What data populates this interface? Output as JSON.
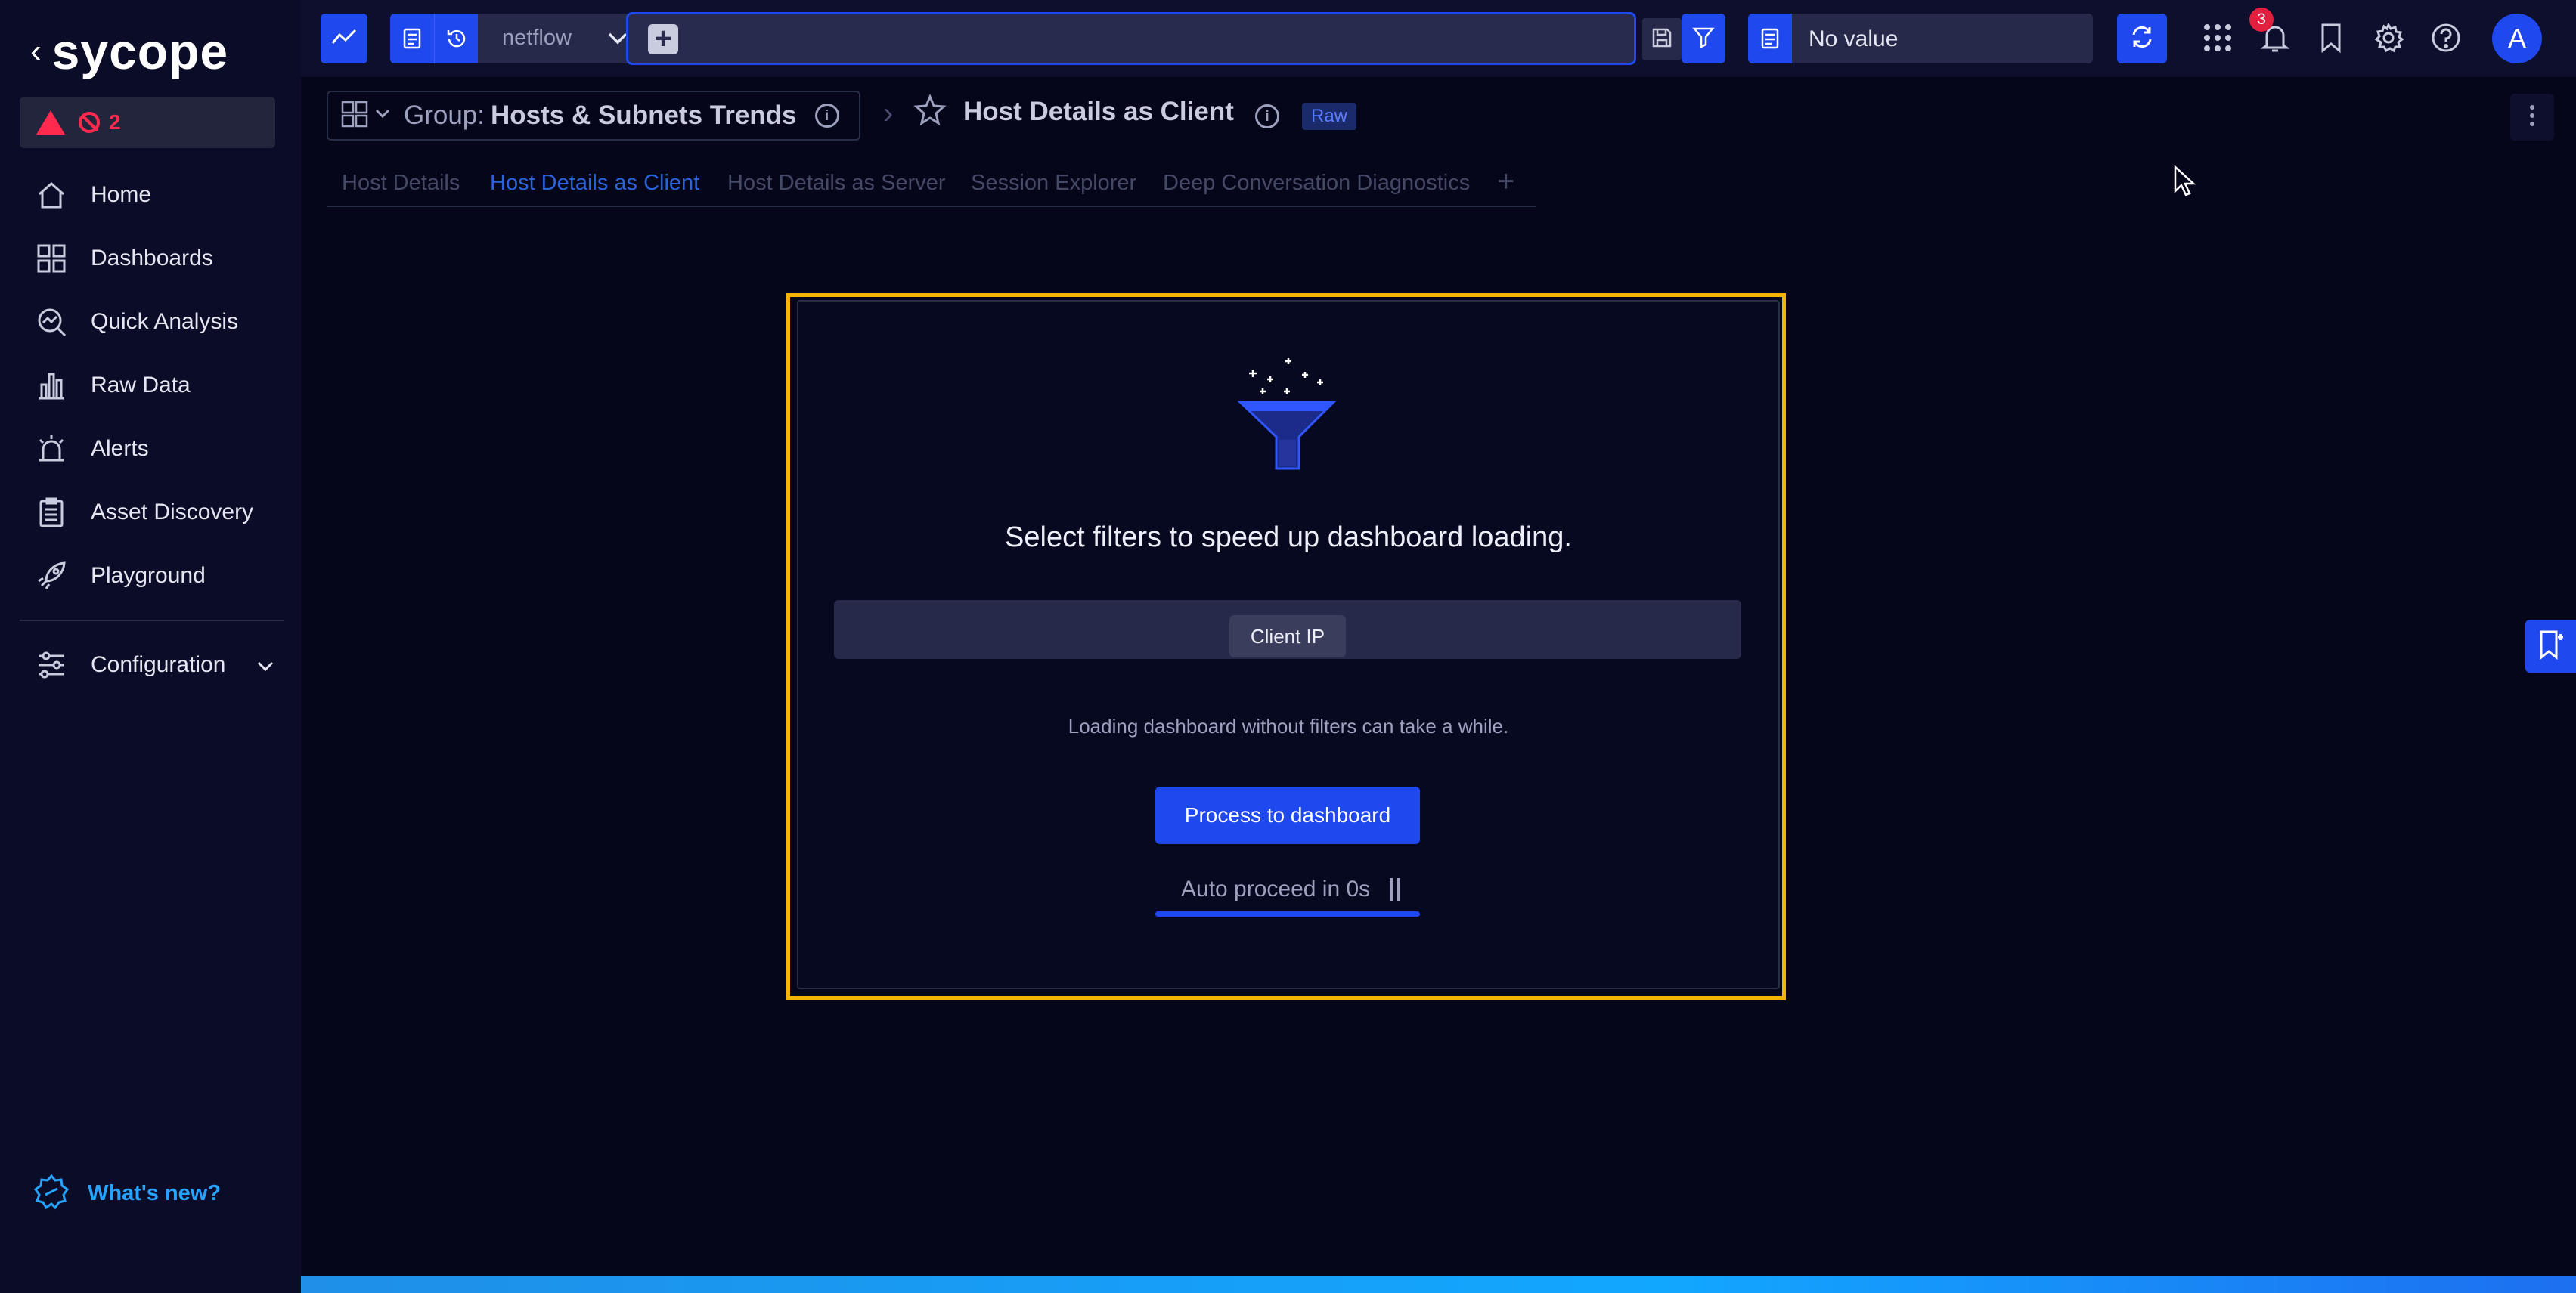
{
  "app": {
    "logo_text": "sycope",
    "alert_count": "2",
    "notification_count": "3",
    "avatar_letter": "A"
  },
  "sidebar": {
    "items": [
      {
        "label": "Home",
        "icon": "home-icon"
      },
      {
        "label": "Dashboards",
        "icon": "dashboards-icon"
      },
      {
        "label": "Quick Analysis",
        "icon": "quick-analysis-icon"
      },
      {
        "label": "Raw Data",
        "icon": "raw-data-icon"
      },
      {
        "label": "Alerts",
        "icon": "alarm-icon"
      },
      {
        "label": "Asset Discovery",
        "icon": "clipboard-icon"
      },
      {
        "label": "Playground",
        "icon": "rocket-icon"
      }
    ],
    "configuration": "Configuration",
    "whats_new": "What's new?"
  },
  "topbar": {
    "datasource": "netflow",
    "search_value": "",
    "context_value": "No value"
  },
  "breadcrumb": {
    "group_prefix": "Group:",
    "group_name": "Hosts & Subnets Trends",
    "title": "Host Details as Client",
    "tag": "Raw"
  },
  "tabs": [
    {
      "label": "Host Details",
      "active": false
    },
    {
      "label": "Host Details as Client",
      "active": true
    },
    {
      "label": "Host Details as Server",
      "active": false
    },
    {
      "label": "Session Explorer",
      "active": false
    },
    {
      "label": "Deep Conversation Diagnostics",
      "active": false
    }
  ],
  "modal": {
    "heading": "Select filters to speed up dashboard loading.",
    "filter_chip": "Client IP",
    "hint": "Loading dashboard without filters can take a while.",
    "proceed_button": "Process to dashboard",
    "auto_proceed": "Auto proceed in 0s",
    "progress_fraction": 1.0
  },
  "colors": {
    "accent": "#1f48ee",
    "highlight_border": "#f5b400",
    "alert": "#ff2a4d",
    "link": "#27a2ff",
    "active_tab": "#2b63d8"
  }
}
